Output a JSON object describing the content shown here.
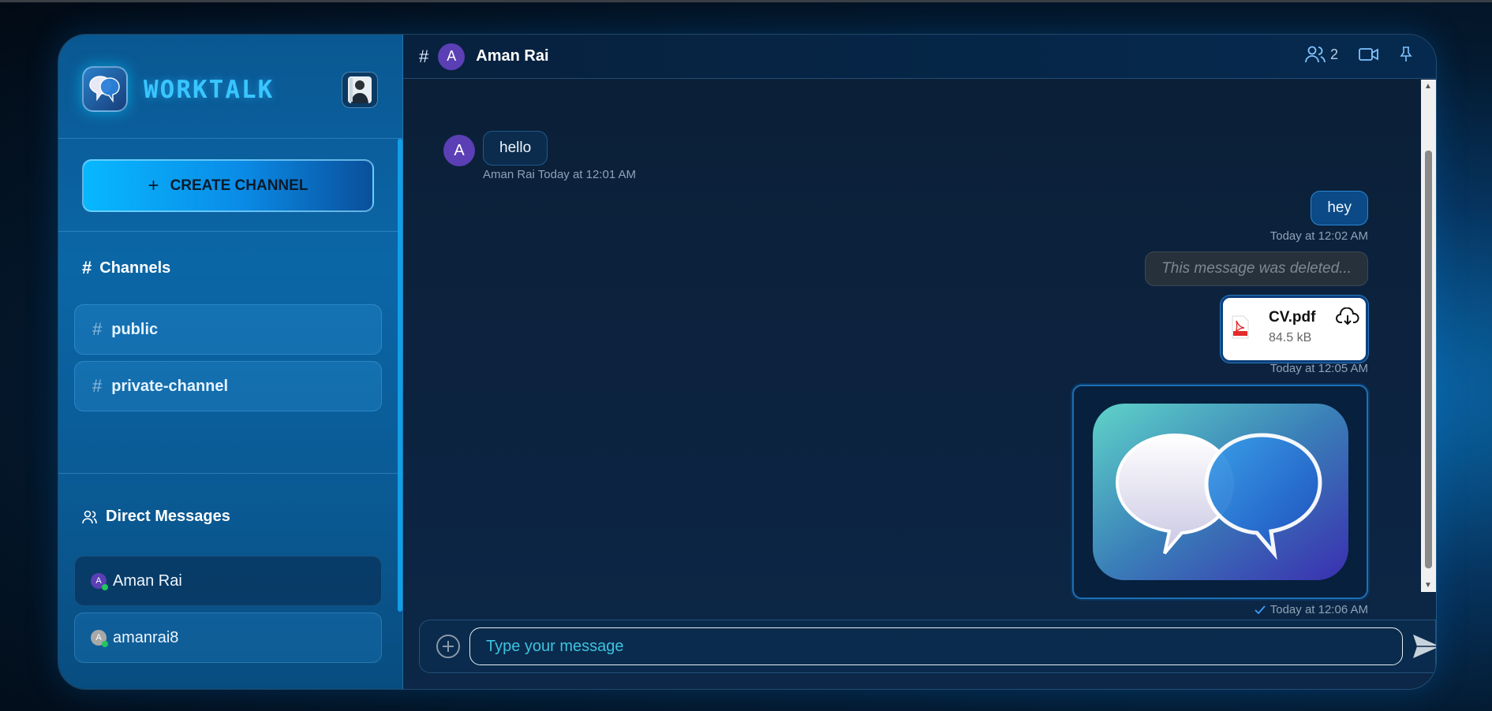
{
  "brand": {
    "name": "WORKTALK"
  },
  "sidebar": {
    "create_label": "CREATE CHANNEL",
    "channels_title": "Channels",
    "channels": [
      {
        "label": "public"
      },
      {
        "label": "private-channel"
      }
    ],
    "dm_title": "Direct Messages",
    "dms": [
      {
        "label": "Aman Rai",
        "initial": "A",
        "avatar_color": "#5b3fb5",
        "online": true,
        "active": true
      },
      {
        "label": "amanrai8",
        "initial": "A",
        "avatar_color": "#a8a8a8",
        "online": true,
        "active": false
      }
    ]
  },
  "chat": {
    "initial": "A",
    "name": "Aman Rai",
    "member_count": "2"
  },
  "messages": [
    {
      "id": "m1",
      "side": "left",
      "text": "hello",
      "meta": "Aman Rai Today at 12:01 AM"
    },
    {
      "id": "m2",
      "side": "right",
      "text": "hey",
      "meta": "Today at 12:02 AM"
    },
    {
      "id": "m3",
      "side": "right",
      "text": "This message was deleted...",
      "deleted": true
    },
    {
      "id": "m4",
      "side": "right",
      "file_name": "CV.pdf",
      "file_size": "84.5 kB",
      "meta": "Today at 12:05 AM"
    },
    {
      "id": "m5",
      "side": "right",
      "image": "worktalk-logo",
      "meta": "Today at 12:06 AM"
    }
  ],
  "composer": {
    "placeholder": "Type your message"
  },
  "colors": {
    "accent": "#39c6ff",
    "avatar": "#5b3fb5",
    "online": "#22c55e"
  },
  "icons": [
    "chat-bubbles-icon",
    "hash-icon",
    "users-icon",
    "video-icon",
    "pin-icon",
    "plus-circle-icon",
    "send-icon",
    "pdf-icon",
    "cloud-download-icon",
    "check-icon"
  ]
}
